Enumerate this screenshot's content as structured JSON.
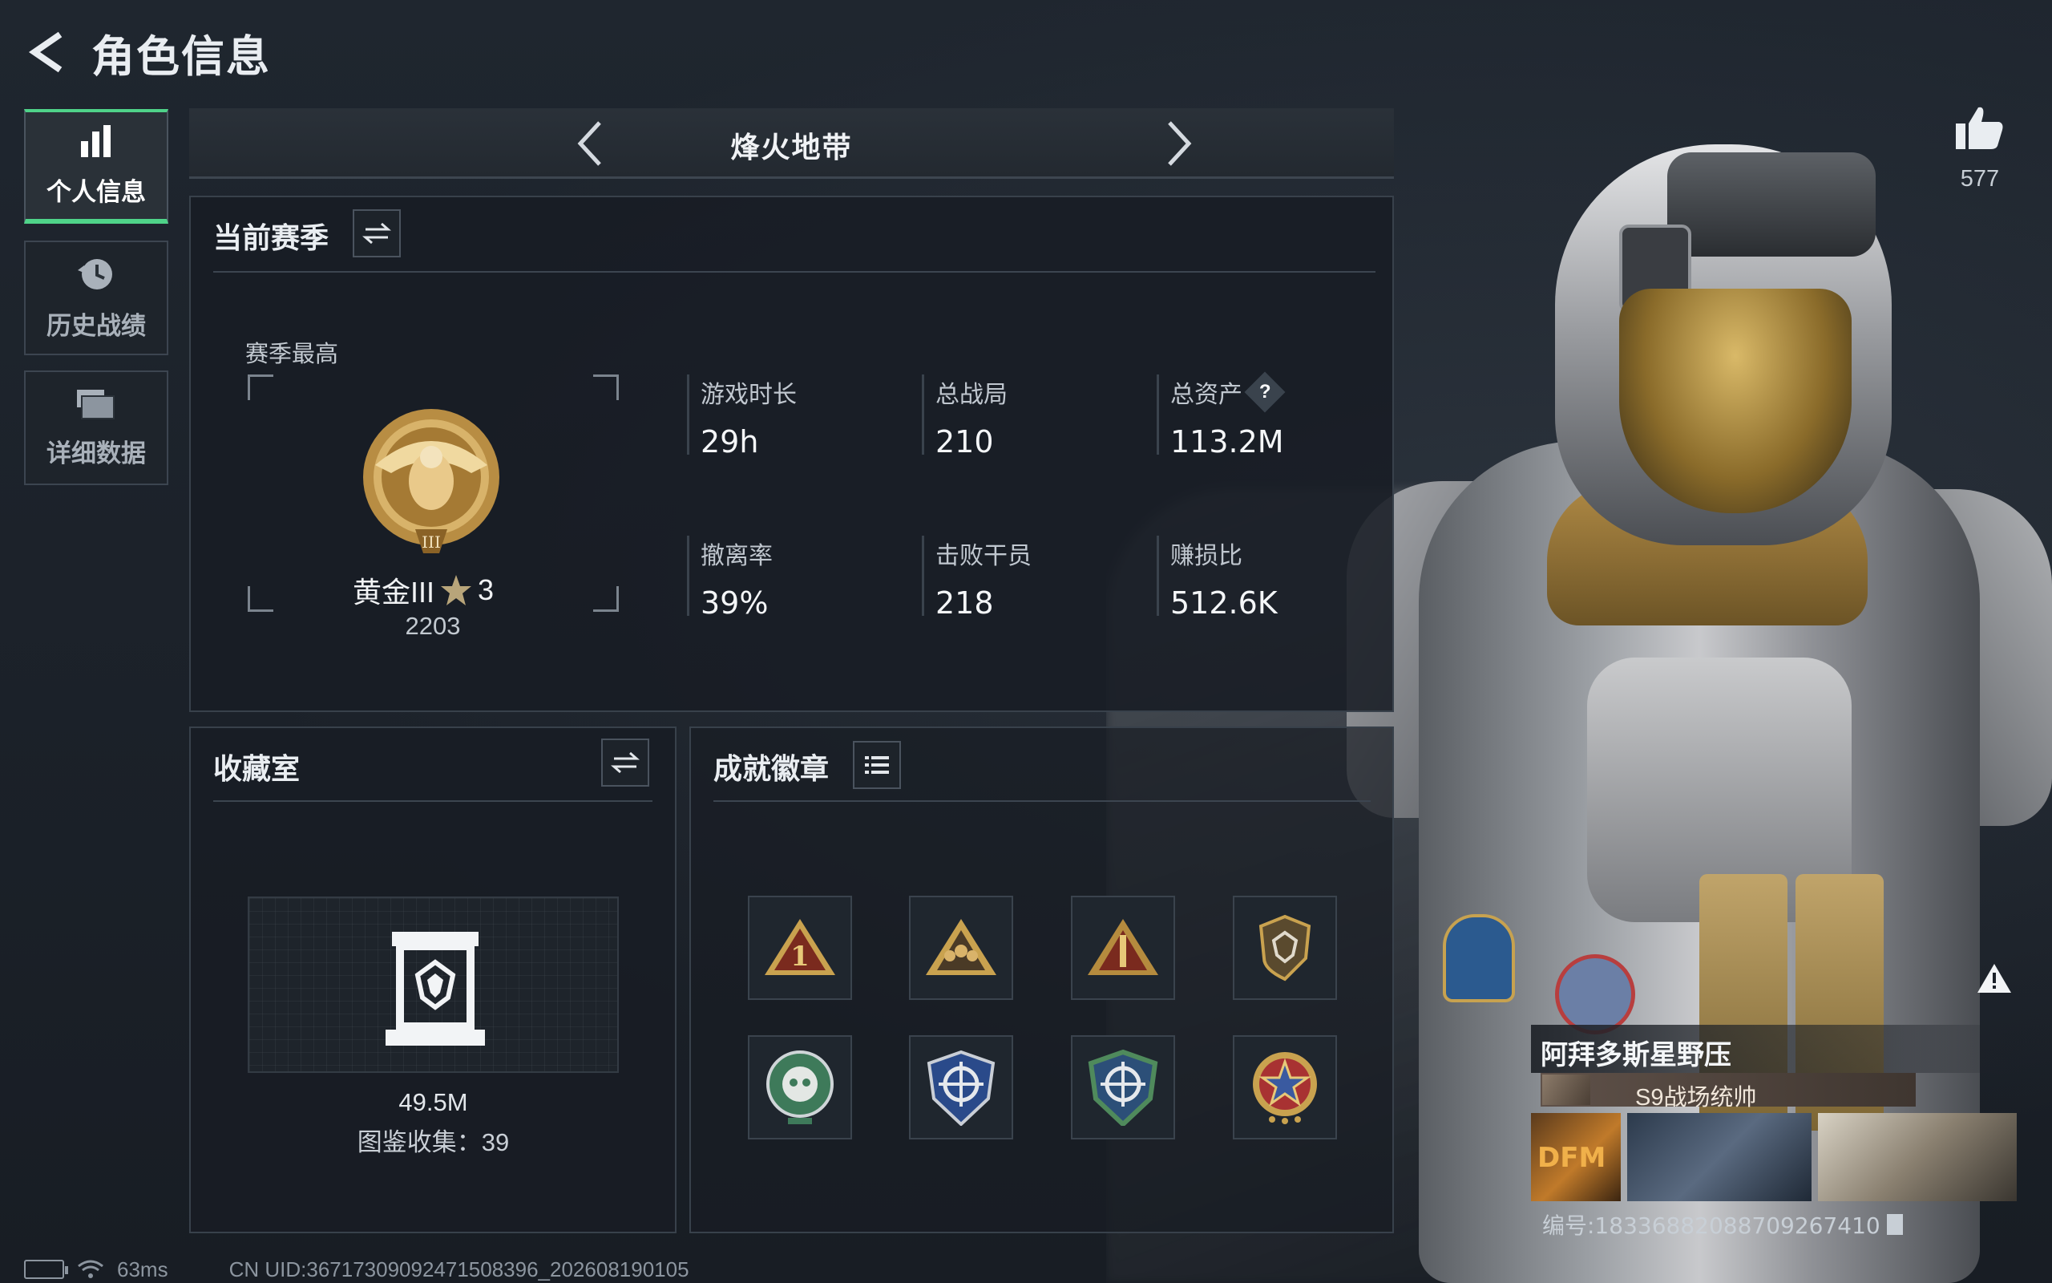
{
  "header": {
    "title": "角色信息"
  },
  "tabs": [
    {
      "label": "个人信息",
      "icon": "bar-chart-icon",
      "active": true
    },
    {
      "label": "历史战绩",
      "icon": "history-clock-icon",
      "active": false
    },
    {
      "label": "详细数据",
      "icon": "folder-icon",
      "active": false
    }
  ],
  "mode": {
    "title": "烽火地带"
  },
  "season": {
    "title": "当前赛季",
    "highest_label": "赛季最高",
    "rank_name": "黄金III",
    "rank_stars": "3",
    "rank_score": "2203",
    "stats": [
      {
        "label": "游戏时长",
        "value": "29h"
      },
      {
        "label": "总战局",
        "value": "210"
      },
      {
        "label": "总资产",
        "value": "113.2M",
        "help": "?"
      },
      {
        "label": "撤离率",
        "value": "39%"
      },
      {
        "label": "击败干员",
        "value": "218"
      },
      {
        "label": "赚损比",
        "value": "512.6K"
      }
    ]
  },
  "collection": {
    "title": "收藏室",
    "value": "49.5M",
    "count_text": "图鉴收集：39"
  },
  "achievements": {
    "title": "成就徽章",
    "badges": [
      {
        "icon": "triangle-rank-1-badge-icon"
      },
      {
        "icon": "triangle-squad-badge-icon"
      },
      {
        "icon": "triangle-rocket-badge-icon"
      },
      {
        "icon": "shield-gem-badge-icon"
      },
      {
        "icon": "green-skull-badge-icon"
      },
      {
        "icon": "blue-crosshair-badge-icon"
      },
      {
        "icon": "green-crosshair-badge-icon"
      },
      {
        "icon": "red-star-badge-icon"
      }
    ]
  },
  "like": {
    "count": "577"
  },
  "player": {
    "name": "阿拜多斯星野压",
    "title": "S9战场统帅",
    "thumb_text": "DFM",
    "id_text": "编号:1833688208870926741​0"
  },
  "status_bar": {
    "ping": "63ms",
    "uid": "CN UID:36717309092471508396_202608190105"
  },
  "colors": {
    "accent_green": "#4fd389",
    "panel_bg": "#181d24",
    "gold": "#c7a250"
  }
}
